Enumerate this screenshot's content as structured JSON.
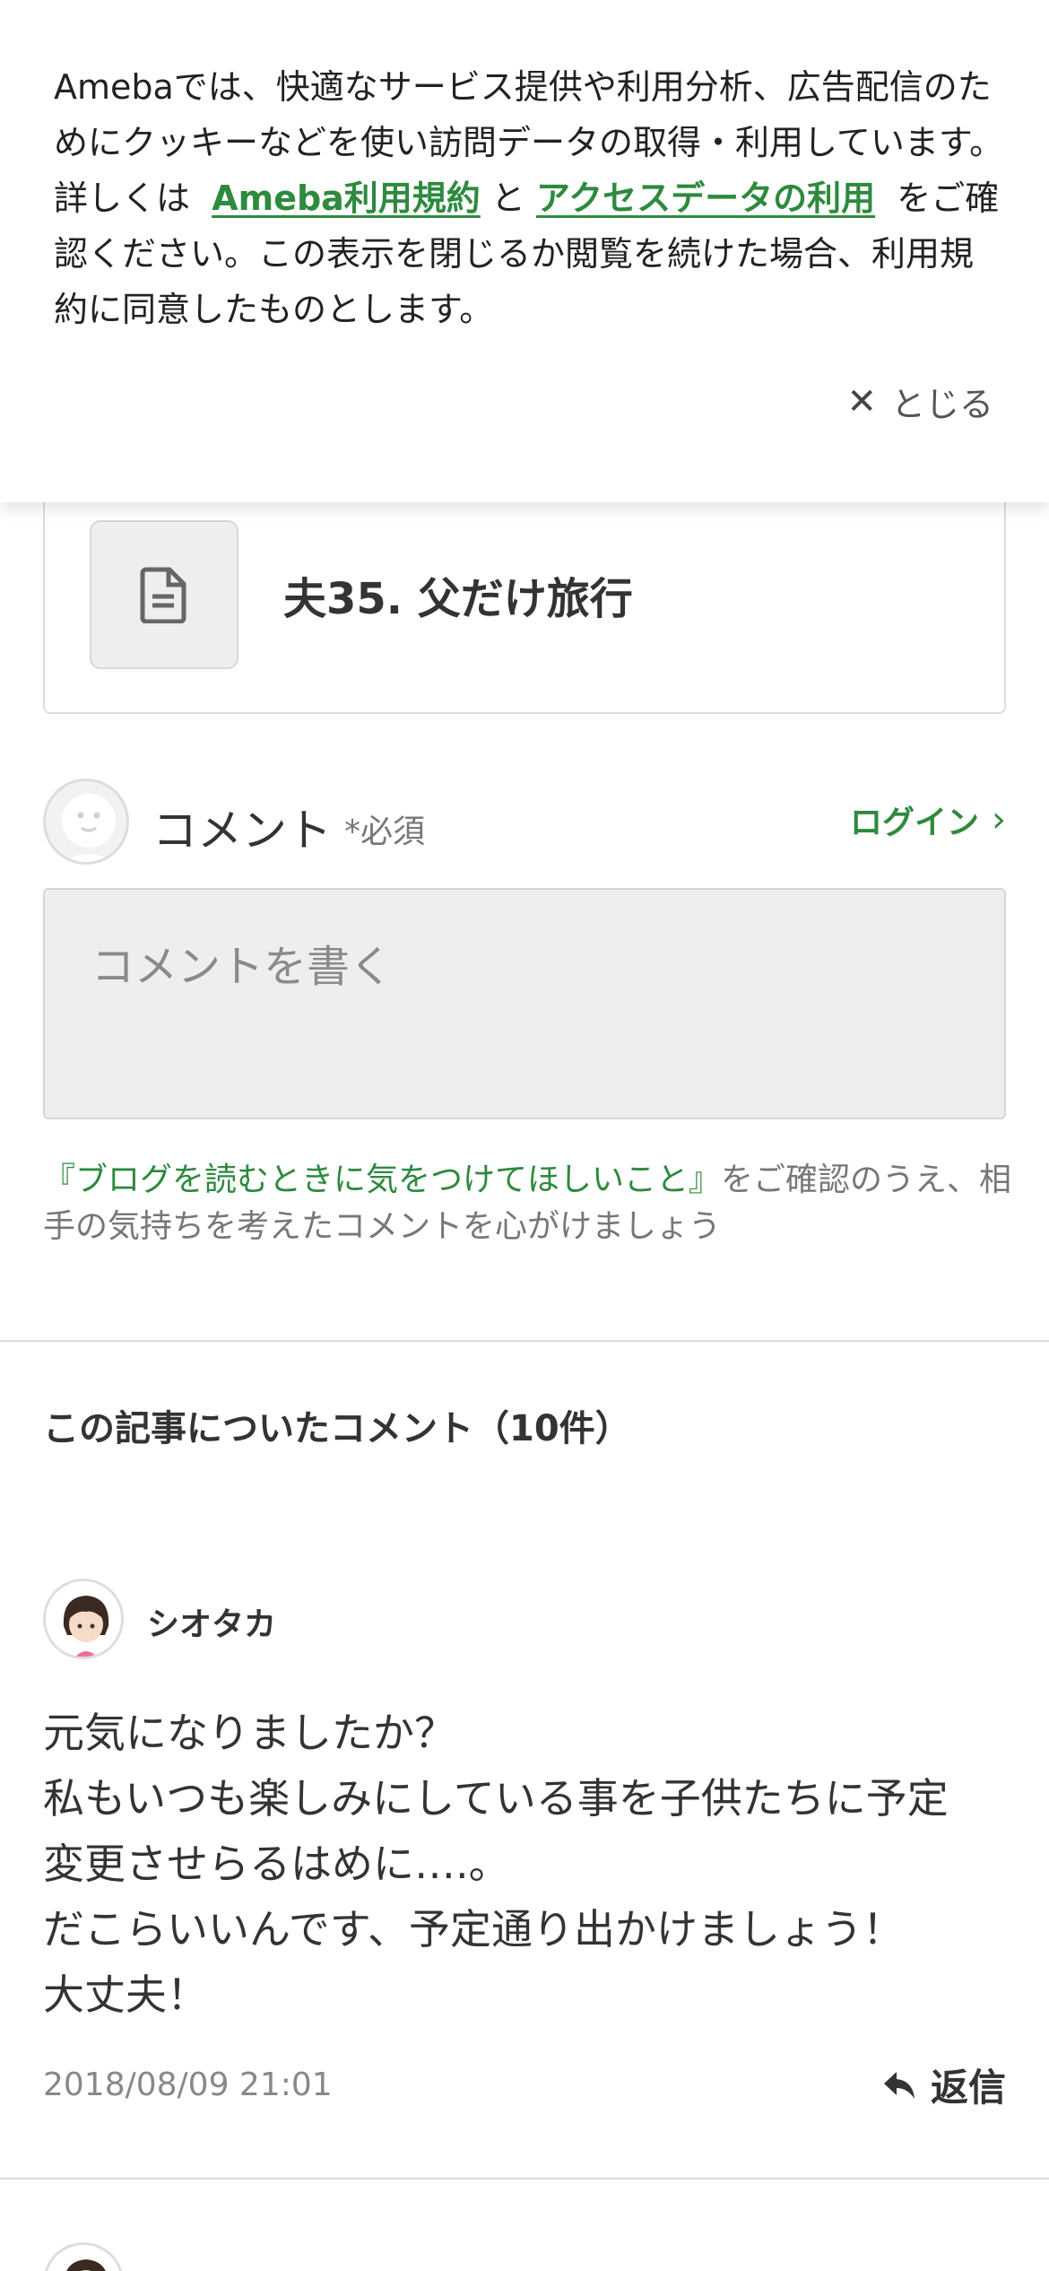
{
  "cookie_banner": {
    "text_1": "Amebaでは、快適なサービス提供や利用分析、広告配信のためにクッキーなどを使い訪問データの取得・利用しています。詳しくは",
    "link_terms": "Ameba利用規約",
    "text_2": "と",
    "link_access": "アクセスデータの利用",
    "text_3": "をご確認ください。この表示を閉じるか閲覧を続けた場合、利用規約に同意したものとします。",
    "close_label": "とじる",
    "close_icon": "close-icon"
  },
  "article": {
    "title": "夫35. 父だけ旅行",
    "icon": "document-icon"
  },
  "comment_form": {
    "label": "コメント",
    "required": "*必須",
    "login": "ログイン",
    "placeholder": "コメントを書く",
    "notice_link": "『ブログを読むときに気をつけてほしいこと』",
    "notice_text": "をご確認のうえ、相手の気持ちを考えたコメントを心がけましょう"
  },
  "comments": {
    "title": "この記事についたコメント（10件）",
    "items": [
      {
        "name": "シオタカ",
        "lines": [
          "元気になりましたか？",
          "私もいつも楽しみにしている事を子供たちに予定",
          "変更させらるはめに….。",
          "だこらいいんです、予定通り出かけましょう！",
          "大丈夫！"
        ],
        "date": "2018/08/09 21:01",
        "reply": "返信"
      }
    ]
  },
  "colors": {
    "accent_green": "#2d8a3e",
    "text": "#333333",
    "muted": "#888888"
  }
}
